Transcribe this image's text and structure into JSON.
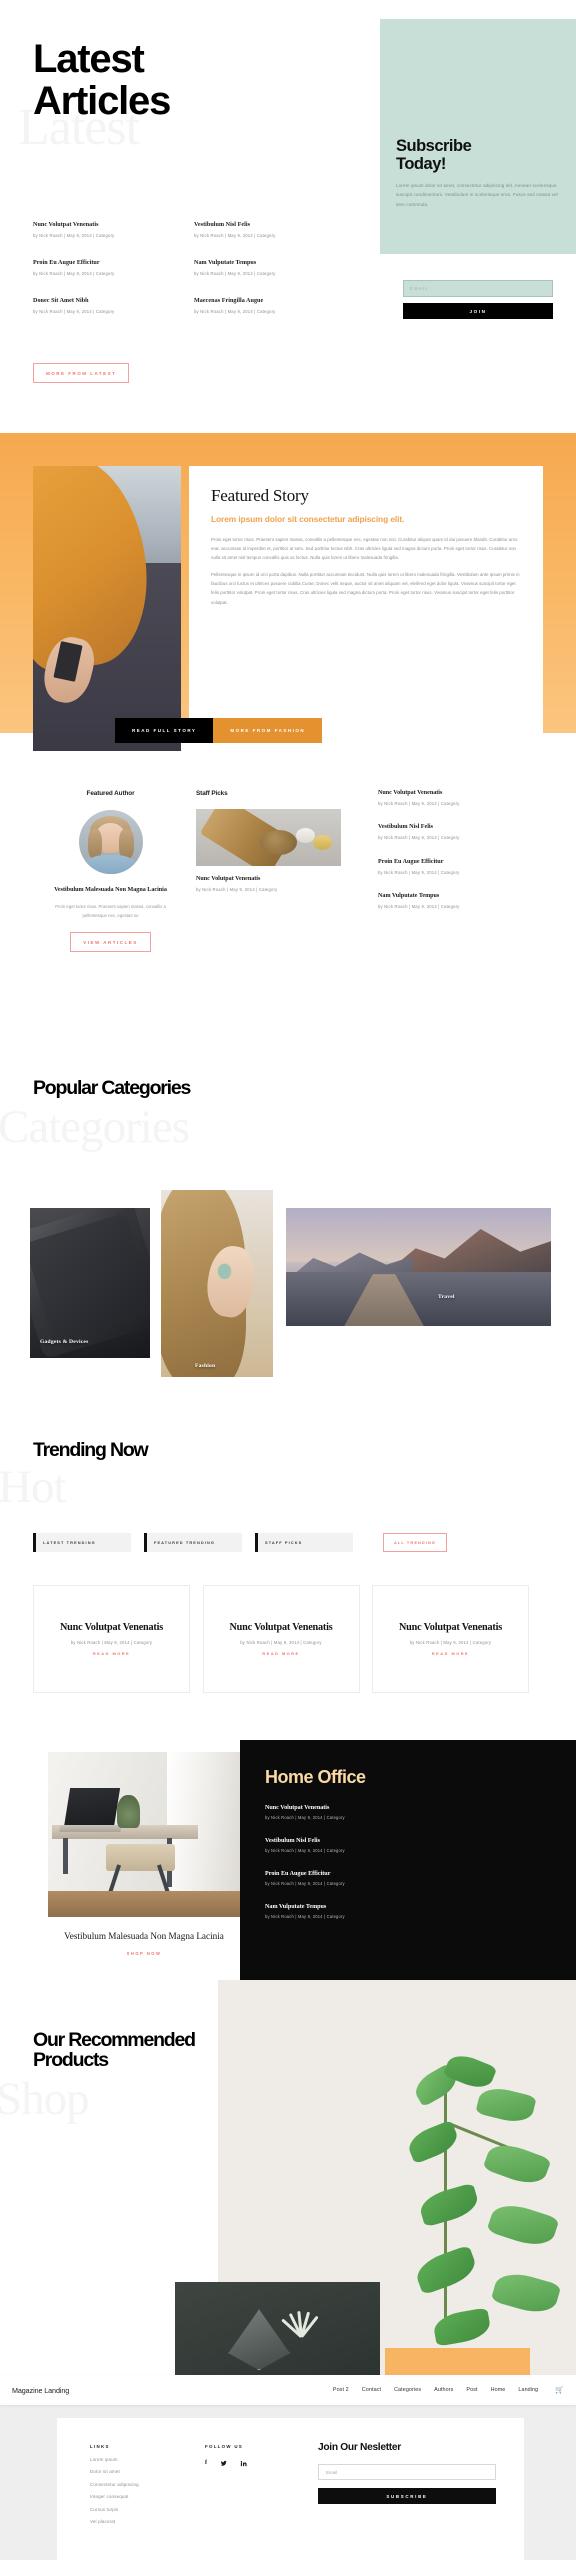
{
  "browser": {
    "brand": "Magazine Landing",
    "nav": [
      {
        "label": "Post 2"
      },
      {
        "label": "Contact"
      },
      {
        "label": "Categories"
      },
      {
        "label": "Authors"
      },
      {
        "label": "Post"
      },
      {
        "label": "Home"
      },
      {
        "label": "Landing"
      }
    ],
    "cart_icon": "cart-icon"
  },
  "latest": {
    "heading_line1": "Latest",
    "heading_line2": "Articles",
    "ghost_word": "Latest",
    "button": "More From Latest",
    "articles": [
      {
        "title": "Nunc Volutpat Venenatis",
        "meta": "by Nick Roach | May 9, 2014 | Category"
      },
      {
        "title": "Vestibulum Nisl Felis",
        "meta": "by Nick Roach | May 9, 2014 | Category"
      },
      {
        "title": "Proin Eu Augue Efficitur",
        "meta": "by Nick Roach | May 9, 2014 | Category"
      },
      {
        "title": "Nam Vulputate Tempus",
        "meta": "by Nick Roach | May 9, 2014 | Category"
      },
      {
        "title": "Donec Sit Amet Nibh",
        "meta": "by Nick Roach | May 9, 2014 | Category"
      },
      {
        "title": "Maecenas Fringilla Augue",
        "meta": "by Nick Roach | May 9, 2014 | Category"
      }
    ]
  },
  "subscribe": {
    "title_line1": "Subscribe",
    "title_line2": "Today!",
    "copy": "Lorem ipsum dolor sit amet, consectetur adipiscing elit. Aenean scelerisque suscipit condimentum. Vestibulum in scelerisque eros. Fusce sed massa vel sem commodo.",
    "input_placeholder": "EMAIL",
    "input_value": "",
    "button": "Join",
    "panel_color": "#c8dfd8"
  },
  "featured": {
    "heading": "Featured Story",
    "subheading": "Lorem ipsum dolor sit consectetur adipiscing elit.",
    "paragraph1": "Proin eget tortor risus. Praesent sapien massa, convallis a pellentesque nec, egestas non nisi. Curabitur aliquet quam id dui posuere blandit. Curabitur arcu erat, accumsan id imperdiet et, porttitor at sem. Sed porttitor lectus nibh. Cras ultricies ligula sed magna dictum porta. Proin eget tortor risus. Curabitur non nulla sit amet nisl tempus convallis quis ac lectus. Nulla quis lorem ut libero malesuada fringilla.",
    "paragraph2": "Pellentesque in ipsum id orci porta dapibus. Nulla porttitor accumsan tincidunt. Nulla quis lorem ut libero malesuada fringilla. Vestibulum ante ipsum primis in faucibus orci luctus et ultrices posuere cubilia Curae; Donec velit neque, auctor sit amet aliquam vel, eleifend eget dolor ligula. Vivamus suscipit tortor eget felis porttitor volutpat. Proin eget tortor risus. Cras ultricies ligula sed magna dictum porta. Proin eget tortor risus. Vivamus suscipit tortor eget felis porttitor volutpat.",
    "btn_read": "Read Full Story",
    "btn_more": "More From Fashion",
    "accent": "#f0a24e"
  },
  "author_section": {
    "author_heading": "Featured Author",
    "author_name": "Vestibulum Malesuada Non Magna Lacinia",
    "author_copy": "Proin eget tortor risus. Praesent sapien massa, convallis a pellentesque nec, egestas no",
    "author_button": "View Articles",
    "staff_heading": "Staff Picks",
    "staff_title": "Nunc Volutpat Venenatis",
    "staff_meta": "by Nick Roach | May 9, 2014 | Category",
    "list": [
      {
        "title": "Nunc Volutpat Venenatis",
        "meta": "by Nick Roach | May 9, 2014 | Category"
      },
      {
        "title": "Vestibulum Nisl Felis",
        "meta": "by Nick Roach | May 9, 2014 | Category"
      },
      {
        "title": "Proin Eu Augue Efficitur",
        "meta": "by Nick Roach | May 9, 2014 | Category"
      },
      {
        "title": "Nam Vulputate Tempus",
        "meta": "by Nick Roach | May 9, 2014 | Category"
      }
    ]
  },
  "categories": {
    "heading": "Popular Categories",
    "ghost_word": "Categories",
    "items": [
      {
        "label": "Gadgets & Devices"
      },
      {
        "label": "Fashion"
      },
      {
        "label": "Travel"
      }
    ]
  },
  "trending": {
    "heading": "Trending Now",
    "ghost_word": "Hot",
    "tabs": [
      {
        "label": "Latest Trending"
      },
      {
        "label": "Featured Trending"
      },
      {
        "label": "Staff Picks"
      }
    ],
    "all_button": "All Trending",
    "cards": [
      {
        "title": "Nunc Volutpat Venenatis",
        "meta": "by Nick Roach | May 9, 2014 | Category",
        "link": "Read More"
      },
      {
        "title": "Nunc Volutpat Venenatis",
        "meta": "by Nick Roach | May 9, 2014 | Category",
        "link": "Read More"
      },
      {
        "title": "Nunc Volutpat Venenatis",
        "meta": "by Nick Roach | May 9, 2014 | Category",
        "link": "Read More"
      }
    ]
  },
  "home_office": {
    "heading": "Home Office",
    "heading_color": "#fbd9a6",
    "card_title": "Vestibulum Malesuada Non Magna Lacinia",
    "card_link": "Shop Now",
    "items": [
      {
        "title": "Nunc Volutpat Venenatis",
        "meta": "by Nick Roach | May 9, 2014 | Category"
      },
      {
        "title": "Vestibulum Nisl Felis",
        "meta": "by Nick Roach | May 9, 2014 | Category"
      },
      {
        "title": "Proin Eu Augue Efficitur",
        "meta": "by Nick Roach | May 9, 2014 | Category"
      },
      {
        "title": "Nam Vulputate Tempus",
        "meta": "by Nick Roach | May 9, 2014 | Category"
      }
    ]
  },
  "shop": {
    "heading_line1": "Our Recommended",
    "heading_line2": "Products",
    "ghost_word": "Shop",
    "accent": "#f7b463"
  },
  "footer": {
    "links_heading": "Links",
    "links": [
      {
        "label": "Lorem ipsum"
      },
      {
        "label": "Dolor sit amet"
      },
      {
        "label": "Consectetur adipiscing"
      },
      {
        "label": "Integer consequat"
      },
      {
        "label": "Cursus turpis"
      },
      {
        "label": "Vel placerat"
      }
    ],
    "follow_heading": "Follow Us",
    "social": [
      {
        "name": "facebook-icon",
        "glyph": "f"
      },
      {
        "name": "twitter-icon",
        "glyph": "ᵗ"
      },
      {
        "name": "linkedin-icon",
        "glyph": "in"
      }
    ],
    "newsletter_heading": "Join Our Nesletter",
    "newsletter_placeholder": "Email",
    "newsletter_value": "",
    "newsletter_button": "Subscribe"
  }
}
